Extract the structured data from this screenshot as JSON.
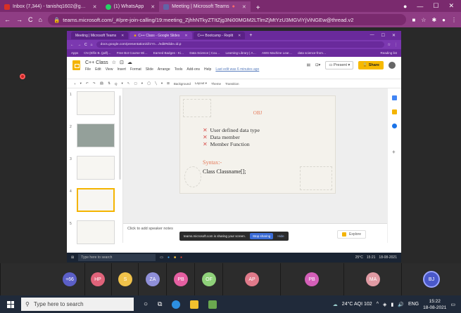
{
  "outer_browser": {
    "tabs": [
      {
        "label": "Inbox (7,344) - tanishq1602@g…",
        "icon_color": "#d93025",
        "active": false
      },
      {
        "label": "(1) WhatsApp",
        "icon_color": "#25d366",
        "active": false
      },
      {
        "label": "Meeting | Microsoft Teams",
        "icon_color": "#6264a7",
        "active": true
      }
    ],
    "new_tab": "+",
    "window_controls": [
      "—",
      "☐",
      "✕"
    ],
    "url": "teams.microsoft.com/_#/pre-join-calling/19:meeting_ZjhhNTkyZTItZjg3Ni00MGM2LTlmZjMtYzU3MGViYjViNGEw@thread.v2",
    "nav": [
      "←",
      "→",
      "C",
      "⌂"
    ]
  },
  "inner_browser": {
    "tabs": [
      {
        "label": "Meeting | Microsoft Teams",
        "active": false
      },
      {
        "label": "C++ Class - Google Slides",
        "active": true
      },
      {
        "label": "C++ Bootcamp - Replit",
        "active": false
      }
    ],
    "url": "docs.google.com/presentation/d/1Yn…/edit#slide=id.p",
    "bookmarks": [
      "Apps",
      "CN (Elfin B. (pdf)…",
      "Free Bot Course Wi…",
      "Earned Badges - Ki…",
      "Data Science | Cou…",
      "Learning Library | A…",
      "AWS Machine Lear…",
      "data science-from…",
      "Reading list"
    ]
  },
  "slides": {
    "doc_title": "C++ Class",
    "title_icons": [
      "☆",
      "⊡",
      "☁"
    ],
    "menu": [
      "File",
      "Edit",
      "View",
      "Insert",
      "Format",
      "Slide",
      "Arrange",
      "Tools",
      "Add-ons",
      "Help"
    ],
    "last_edit": "Last edit was 6 minutes ago",
    "present_label": "Present",
    "share_label": "Share",
    "toolbar": [
      "+",
      "▾",
      "↶",
      "↷",
      "🖨",
      "⇅",
      "Q",
      "▾",
      "↖",
      "▢",
      "▾",
      "◯",
      "╲",
      "▾",
      "⊞",
      "Background",
      "Layout ▾",
      "Theme",
      "Transition"
    ],
    "thumb_numbers": [
      "1",
      "2",
      "3",
      "4",
      "5"
    ],
    "slide": {
      "title": "OBJ",
      "bullets": [
        "User defined data type",
        "Data member",
        "Member Function"
      ],
      "bullet_marker": "✕",
      "syntax_label": "Syntax:-",
      "syntax_code": "Class Classname[];"
    },
    "speaker_notes": "Click to add speaker notes",
    "explore": "Explore"
  },
  "sharing_bar": {
    "text": "teams.microsoft.com is sharing your screen.",
    "stop": "Stop sharing",
    "hide": "Hide"
  },
  "inner_taskbar": {
    "search": "Type here to search",
    "tray": "25°C",
    "time": "15:21",
    "date": "18-08-2021"
  },
  "participants": [
    {
      "initials": "+66",
      "color": "#5b5fc7"
    },
    {
      "initials": "HP",
      "color": "#e0637a"
    },
    {
      "initials": "S",
      "color": "#f0c24a"
    },
    {
      "initials": "ZA",
      "color": "#8f8fd8"
    },
    {
      "initials": "PB",
      "color": "#e55fa1"
    },
    {
      "initials": "OF",
      "color": "#8fd17a"
    },
    {
      "initials": "AP",
      "color": "#e07a8a"
    },
    {
      "initials": "PB",
      "color": "#d45fb8"
    },
    {
      "initials": "MA",
      "color": "#e09aa3"
    },
    {
      "initials": "BJ",
      "color": "#4a58c9"
    }
  ],
  "taskbar": {
    "search_placeholder": "Type here to search",
    "weather": "24°C AQI 102",
    "lang": "ENG",
    "time": "15:22",
    "date": "18-08-2021"
  }
}
